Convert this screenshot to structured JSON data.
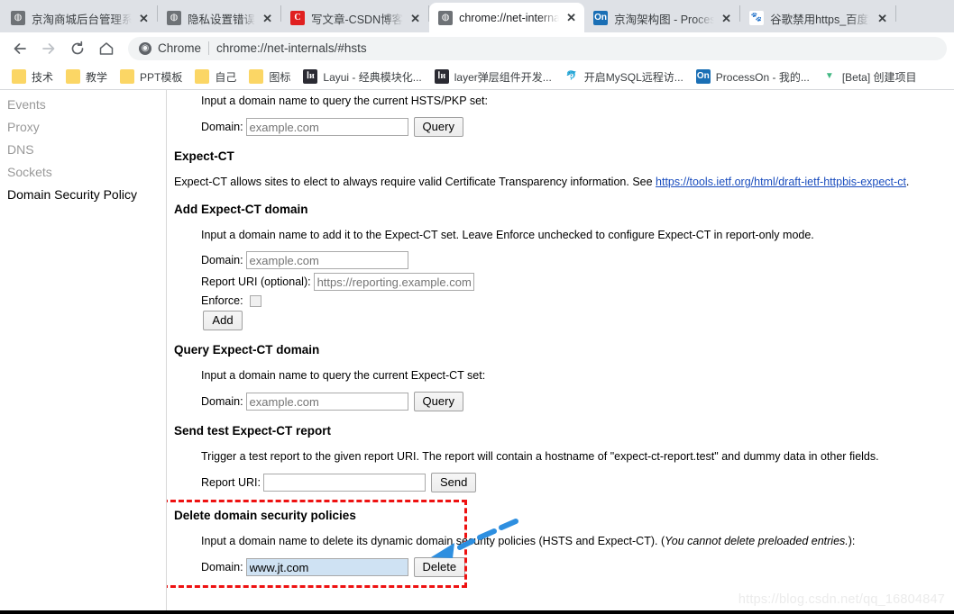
{
  "browser": {
    "tabs": [
      {
        "title": "京淘商城后台管理系统",
        "favicon": "globe-icon",
        "active": false,
        "close_label": "✕"
      },
      {
        "title": "隐私设置错误",
        "favicon": "globe-icon",
        "active": false,
        "close_label": "✕"
      },
      {
        "title": "写文章-CSDN博客",
        "favicon": "csdn-icon",
        "favicon_glyph": "C",
        "active": false,
        "close_label": "✕"
      },
      {
        "title": "chrome://net-internals/#hsts",
        "favicon": "globe-icon",
        "active": true,
        "close_label": "✕"
      },
      {
        "title": "京淘架构图 - ProcessOn",
        "favicon": "processon-icon",
        "favicon_glyph": "On",
        "active": false,
        "close_label": "✕"
      },
      {
        "title": "谷歌禁用https_百度搜索",
        "favicon": "baidu-icon",
        "favicon_glyph": "🐾",
        "active": false,
        "close_label": "✕"
      }
    ],
    "toolbar": {
      "back_label": "←",
      "forward_label": "→",
      "reload_label": "⟳",
      "home_label": "⌂"
    },
    "omnibox": {
      "scheme_label": "Chrome",
      "url": "chrome://net-internals/#hsts",
      "chrome_icon_glyph": "◉"
    },
    "bookmarks": [
      {
        "label": "技术",
        "icon": "folder-icon"
      },
      {
        "label": "教学",
        "icon": "folder-icon"
      },
      {
        "label": "PPT模板",
        "icon": "folder-icon"
      },
      {
        "label": "自己",
        "icon": "folder-icon"
      },
      {
        "label": "图标",
        "icon": "folder-icon"
      },
      {
        "label": "Layui - 经典模块化...",
        "icon": "layui-icon",
        "icon_glyph": "Ⅰи"
      },
      {
        "label": "layer弹层组件开发...",
        "icon": "layui-icon",
        "icon_glyph": "Ⅰи"
      },
      {
        "label": "开启MySQL远程访...",
        "icon": "mysql-icon",
        "icon_glyph": "🐬"
      },
      {
        "label": "ProcessOn - 我的...",
        "icon": "processon-icon",
        "icon_glyph": "On"
      },
      {
        "label": "[Beta] 创建项目",
        "icon": "vue-icon",
        "icon_glyph": "▼"
      }
    ]
  },
  "sidebar": {
    "items": [
      {
        "label": "Events",
        "selected": false
      },
      {
        "label": "Proxy",
        "selected": false
      },
      {
        "label": "DNS",
        "selected": false
      },
      {
        "label": "Sockets",
        "selected": false
      },
      {
        "label": "Domain Security Policy",
        "selected": true
      }
    ]
  },
  "main": {
    "hsts_query": {
      "description": "Input a domain name to query the current HSTS/PKP set:",
      "domain_label": "Domain:",
      "domain_placeholder": "example.com",
      "domain_value": "",
      "query_button": "Query"
    },
    "expect_ct": {
      "heading": "Expect-CT",
      "description_pre": "Expect-CT allows sites to elect to always require valid Certificate Transparency information. See ",
      "link_text": "https://tools.ietf.org/html/draft-ietf-httpbis-expect-ct",
      "description_post": "."
    },
    "add_expect_ct": {
      "heading": "Add Expect-CT domain",
      "description": "Input a domain name to add it to the Expect-CT set. Leave Enforce unchecked to configure Expect-CT in report-only mode.",
      "domain_label": "Domain:",
      "domain_placeholder": "example.com",
      "domain_value": "",
      "report_uri_label": "Report URI (optional):",
      "report_uri_placeholder": "https://reporting.example.com",
      "report_uri_value": "",
      "enforce_label": "Enforce:",
      "enforce_checked": false,
      "add_button": "Add"
    },
    "query_expect_ct": {
      "heading": "Query Expect-CT domain",
      "description": "Input a domain name to query the current Expect-CT set:",
      "domain_label": "Domain:",
      "domain_placeholder": "example.com",
      "domain_value": "",
      "query_button": "Query"
    },
    "send_report": {
      "heading": "Send test Expect-CT report",
      "description": "Trigger a test report to the given report URI. The report will contain a hostname of \"expect-ct-report.test\" and dummy data in other fields.",
      "report_uri_label": "Report URI:",
      "report_uri_value": "",
      "send_button": "Send"
    },
    "delete_policies": {
      "heading": "Delete domain security policies",
      "description_pre": "Input a domain name to delete its dynamic domain security policies (HSTS and Expect-CT). (",
      "description_italic": "You cannot delete preloaded entries.",
      "description_post": "):",
      "domain_label": "Domain:",
      "domain_value": "www.jt.com",
      "delete_button": "Delete"
    }
  },
  "annotations": {
    "highlight_box_color": "#ee1111",
    "arrow_color": "#2e8fe0",
    "watermark": "https://blog.csdn.net/qq_16804847"
  }
}
